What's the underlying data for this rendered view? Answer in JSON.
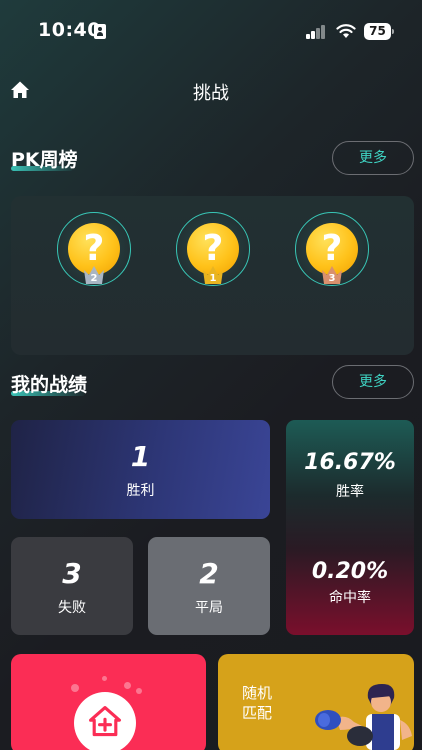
{
  "status_bar": {
    "time": "10:40",
    "battery": "75"
  },
  "nav": {
    "title": "挑战"
  },
  "pk_section": {
    "title": "PK周榜",
    "more": "更多"
  },
  "leaderboard": [
    {
      "rank": "2",
      "avatar": "?"
    },
    {
      "rank": "1",
      "avatar": "?"
    },
    {
      "rank": "3",
      "avatar": "?"
    }
  ],
  "record_section": {
    "title": "我的战绩",
    "more": "更多"
  },
  "stats": {
    "wins": {
      "value": "1",
      "label": "胜利"
    },
    "win_rate": {
      "value": "16.67%",
      "label": "胜率"
    },
    "losses": {
      "value": "3",
      "label": "失败"
    },
    "draws": {
      "value": "2",
      "label": "平局"
    },
    "hit_rate": {
      "value": "0.20%",
      "label": "命中率"
    }
  },
  "actions": {
    "create_room_icon": "house-plus-icon",
    "random_match": {
      "label_line1": "随机",
      "label_line2": "匹配"
    }
  },
  "colors": {
    "accent": "#3fd3c3",
    "create_room": "#fb2d55",
    "random_match": "#d6a21a",
    "gold": "#e8b421",
    "silver": "#a9b5c3",
    "bronze": "#d9906d"
  }
}
